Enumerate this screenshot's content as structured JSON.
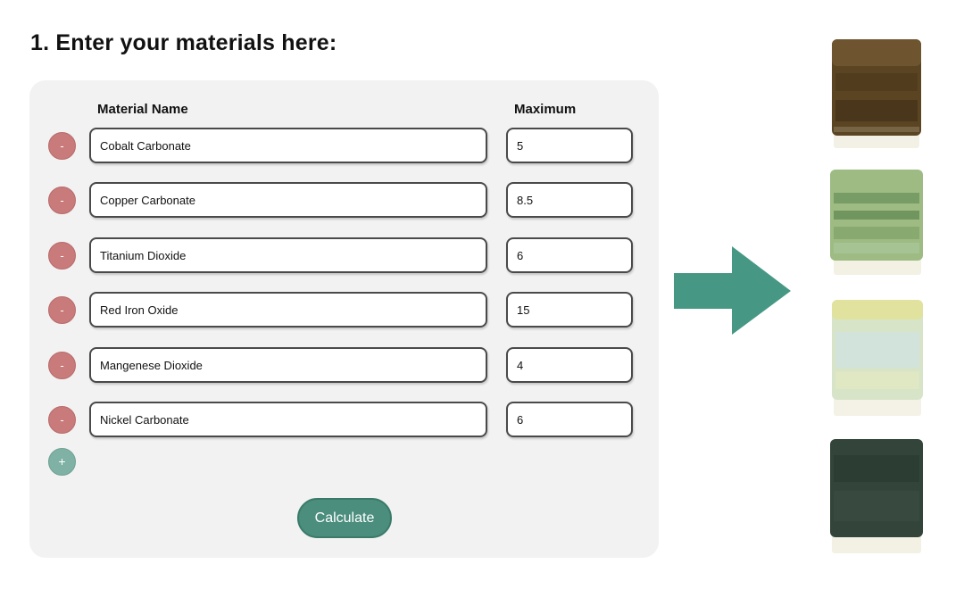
{
  "header": {
    "title": "1. Enter your materials here:"
  },
  "form": {
    "columns": {
      "name": "Material Name",
      "maximum": "Maximum"
    },
    "remove_label": "-",
    "add_label": "+",
    "rows": [
      {
        "name": "Cobalt Carbonate",
        "maximum": "5"
      },
      {
        "name": "Copper Carbonate",
        "maximum": "8.5"
      },
      {
        "name": "Titanium Dioxide",
        "maximum": "6"
      },
      {
        "name": "Red Iron Oxide",
        "maximum": "15"
      },
      {
        "name": "Mangenese Dioxide",
        "maximum": "4"
      },
      {
        "name": "Nickel Carbonate",
        "maximum": "6"
      }
    ],
    "calculate_label": "Calculate"
  },
  "colors": {
    "remove": "#c97a7a",
    "add": "#7fb2a4",
    "accent": "#4b8e7d",
    "arrow": "#469884"
  },
  "glaze_tiles": [
    {
      "name": "brown-glaze-tile",
      "color": "#5a4422"
    },
    {
      "name": "green-speckled-glaze-tile",
      "color": "#9dbb82"
    },
    {
      "name": "pale-yellow-glaze-tile",
      "color": "#d8e4c8"
    },
    {
      "name": "dark-green-glaze-tile",
      "color": "#33453a"
    }
  ]
}
